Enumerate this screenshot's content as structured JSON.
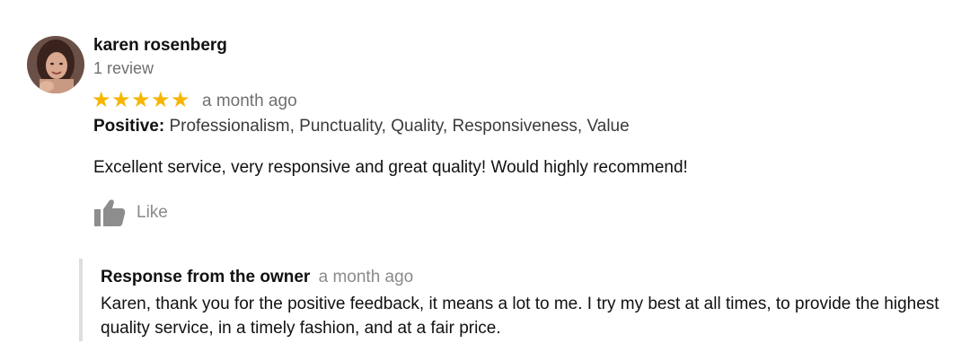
{
  "review": {
    "reviewer_name": "karen rosenberg",
    "review_count": "1 review",
    "rating": 5,
    "rating_max": 5,
    "time": "a month ago",
    "positive_label": "Positive:",
    "positive_items": "Professionalism, Punctuality, Quality, Responsiveness, Value",
    "text": "Excellent service, very responsive and great quality! Would highly recommend!",
    "like_label": "Like",
    "avatar_icon": "person-photo-icon",
    "like_icon": "thumbs-up-icon"
  },
  "owner_response": {
    "title": "Response from the owner",
    "time": "a month ago",
    "text": "Karen, thank you for the positive feedback, it means a lot to me. I try my best at all times, to provide the highest quality service, in a timely fashion, and at a fair price."
  },
  "colors": {
    "star": "#f7b500",
    "muted_text": "#707070",
    "border": "#dedede"
  }
}
